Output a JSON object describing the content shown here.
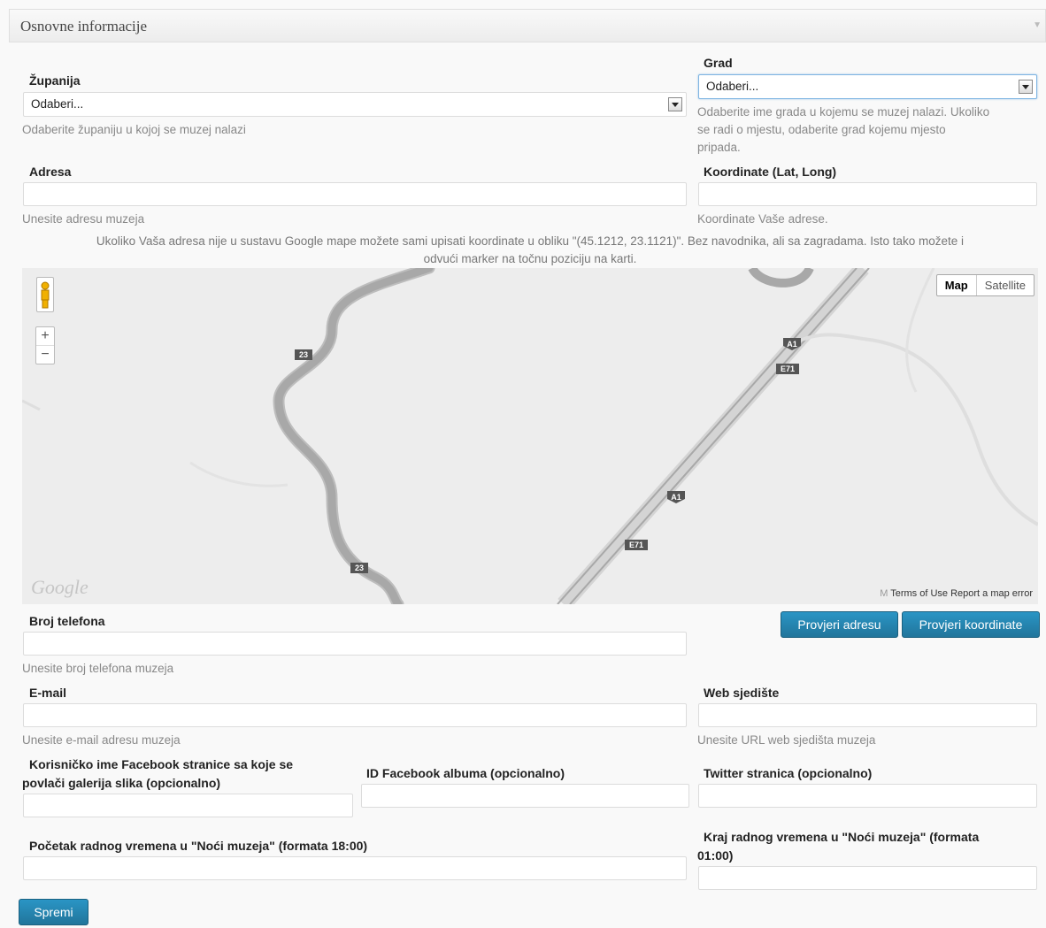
{
  "panel": {
    "title": "Osnovne informacije"
  },
  "zupanija": {
    "label": "Županija",
    "value": "Odaberi...",
    "hint": "Odaberite županiju u kojoj se muzej nalazi"
  },
  "grad": {
    "label": "Grad",
    "value": "Odaberi...",
    "hint_lines": [
      "Odaberite ime grada u kojemu se muzej nalazi. Ukoliko",
      "se radi o mjestu, odaberite grad kojemu mjesto",
      "pripada."
    ]
  },
  "adresa": {
    "label": "Adresa",
    "value": "",
    "hint": "Unesite adresu muzeja"
  },
  "koordinate": {
    "label": "Koordinate (Lat, Long)",
    "value": "",
    "hint": "Koordinate Vaše adrese."
  },
  "coords_note_lines": [
    "Ukoliko Vaša adresa nije u sustavu Google mape možete sami upisati koordinate u obliku \"(45.1212, 23.1121)\". Bez navodnika, ali sa zagradama. Isto tako možete i",
    "odvući marker na točnu poziciju na karti."
  ],
  "map": {
    "type_map": "Map",
    "type_satellite": "Satellite",
    "zoom_in": "+",
    "zoom_out": "−",
    "road_labels": [
      "23",
      "23",
      "A1",
      "A1",
      "E71",
      "E71"
    ],
    "logo": "Google",
    "footer": "Terms of Use   Report a map error",
    "map_data_prefix": "M"
  },
  "buttons": {
    "check_address": "Provjeri adresu",
    "check_coords": "Provjeri koordinate",
    "save": "Spremi"
  },
  "telefon": {
    "label": "Broj telefona",
    "value": "",
    "hint": "Unesite broj telefona muzeja"
  },
  "email": {
    "label": "E-mail",
    "value": "",
    "hint": "Unesite e-mail adresu muzeja"
  },
  "web": {
    "label": "Web sjedište",
    "value": "",
    "hint": "Unesite URL web sjedišta muzeja"
  },
  "facebook_page": {
    "label_lines": [
      "Korisničko ime Facebook stranice sa koje se",
      "povlači galerija slika (opcionalno)"
    ],
    "value": ""
  },
  "facebook_album": {
    "label": "ID Facebook albuma (opcionalno)",
    "value": ""
  },
  "twitter": {
    "label": "Twitter stranica (opcionalno)",
    "value": ""
  },
  "start_time": {
    "label": "Početak radnog vremena u \"Noći muzeja\" (formata 18:00)",
    "value": ""
  },
  "end_time": {
    "label_lines": [
      "Kraj radnog vremena u \"Noći muzeja\" (formata",
      "01:00)"
    ],
    "value": ""
  }
}
